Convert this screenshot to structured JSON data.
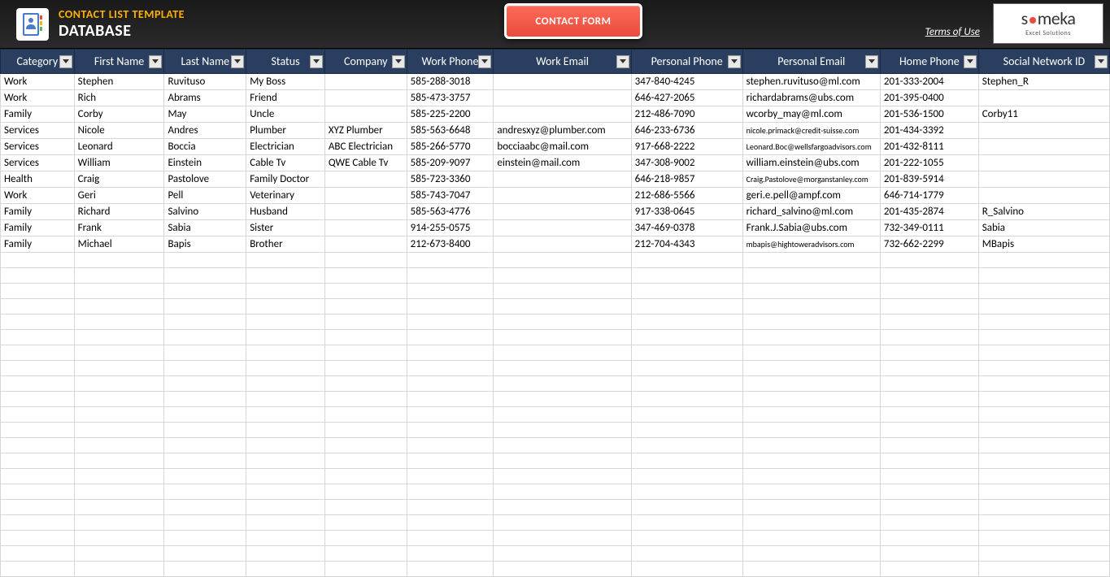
{
  "header": {
    "title1": "CONTACT LIST TEMPLATE",
    "title2": "DATABASE",
    "contact_form_button": "CONTACT FORM",
    "terms_link": "Terms of Use",
    "logo_text": "someka",
    "logo_sub": "Excel Solutions"
  },
  "columns": [
    "Category",
    "First Name",
    "Last Name",
    "Status",
    "Company",
    "Work Phone",
    "Work Email",
    "Personal Phone",
    "Personal Email",
    "Home Phone",
    "Social Network ID"
  ],
  "rows": [
    {
      "category": "Work",
      "firstname": "Stephen",
      "lastname": "Ruvituso",
      "status": "My Boss",
      "company": "",
      "workphone": "585-288-3018",
      "workemail": "",
      "personalphone": "347-840-4245",
      "personalemail": "stephen.ruvituso@ml.com",
      "homephone": "201-333-2004",
      "social": "Stephen_R"
    },
    {
      "category": "Work",
      "firstname": "Rich",
      "lastname": "Abrams",
      "status": "Friend",
      "company": "",
      "workphone": "585-473-3757",
      "workemail": "",
      "personalphone": "646-427-2065",
      "personalemail": "richardabrams@ubs.com",
      "homephone": "201-395-0400",
      "social": ""
    },
    {
      "category": "Family",
      "firstname": "Corby",
      "lastname": "May",
      "status": "Uncle",
      "company": "",
      "workphone": "585-225-2200",
      "workemail": "",
      "personalphone": "212-486-7090",
      "personalemail": "wcorby_may@ml.com",
      "homephone": "201-536-1500",
      "social": "Corby11"
    },
    {
      "category": "Services",
      "firstname": "Nicole",
      "lastname": "Andres",
      "status": "Plumber",
      "company": "XYZ Plumber",
      "workphone": "585-563-6648",
      "workemail": "andresxyz@plumber.com",
      "personalphone": "646-233-6736",
      "personalemail": "nicole.primack@credit-suisse.com",
      "homephone": "201-434-3392",
      "social": "",
      "small": true
    },
    {
      "category": "Services",
      "firstname": "Leonard",
      "lastname": "Boccia",
      "status": "Electrician",
      "company": "ABC Electrician",
      "workphone": "585-266-5770",
      "workemail": "bocciaabc@mail.com",
      "personalphone": "917-668-2222",
      "personalemail": "Leonard.Boc@wellsfargoadvisors.com",
      "homephone": "201-432-8111",
      "social": "",
      "small": true
    },
    {
      "category": "Services",
      "firstname": "William",
      "lastname": "Einstein",
      "status": "Cable Tv",
      "company": "QWE Cable Tv",
      "workphone": "585-209-9097",
      "workemail": "einstein@mail.com",
      "personalphone": "347-308-9002",
      "personalemail": "william.einstein@ubs.com",
      "homephone": "201-222-1055",
      "social": ""
    },
    {
      "category": "Health",
      "firstname": "Craig",
      "lastname": "Pastolove",
      "status": "Family Doctor",
      "company": "",
      "workphone": "585-723-3360",
      "workemail": "",
      "personalphone": "646-218-9857",
      "personalemail": "Craig.Pastolove@morganstanley.com",
      "homephone": "201-839-5914",
      "social": "",
      "small": true
    },
    {
      "category": "Work",
      "firstname": "Geri",
      "lastname": "Pell",
      "status": "Veterinary",
      "company": "",
      "workphone": "585-743-7047",
      "workemail": "",
      "personalphone": "212-686-5566",
      "personalemail": "geri.e.pell@ampf.com",
      "homephone": "646-714-1779",
      "social": ""
    },
    {
      "category": "Family",
      "firstname": "Richard",
      "lastname": "Salvino",
      "status": "Husband",
      "company": "",
      "workphone": "585-563-4776",
      "workemail": "",
      "personalphone": "917-338-0645",
      "personalemail": "richard_salvino@ml.com",
      "homephone": "201-435-2874",
      "social": "R_Salvino"
    },
    {
      "category": "Family",
      "firstname": "Frank",
      "lastname": "Sabia",
      "status": "Sister",
      "company": "",
      "workphone": "914-255-0575",
      "workemail": "",
      "personalphone": "347-469-0378",
      "personalemail": "Frank.J.Sabia@ubs.com",
      "homephone": "732-349-0111",
      "social": "Sabia"
    },
    {
      "category": "Family",
      "firstname": "Michael",
      "lastname": "Bapis",
      "status": "Brother",
      "company": "",
      "workphone": "212-673-8400",
      "workemail": "",
      "personalphone": "212-704-4343",
      "personalemail": "mbapis@hightoweradvisors.com",
      "homephone": "732-662-2299",
      "social": "MBapis",
      "small": true
    }
  ],
  "empty_rows": 21
}
